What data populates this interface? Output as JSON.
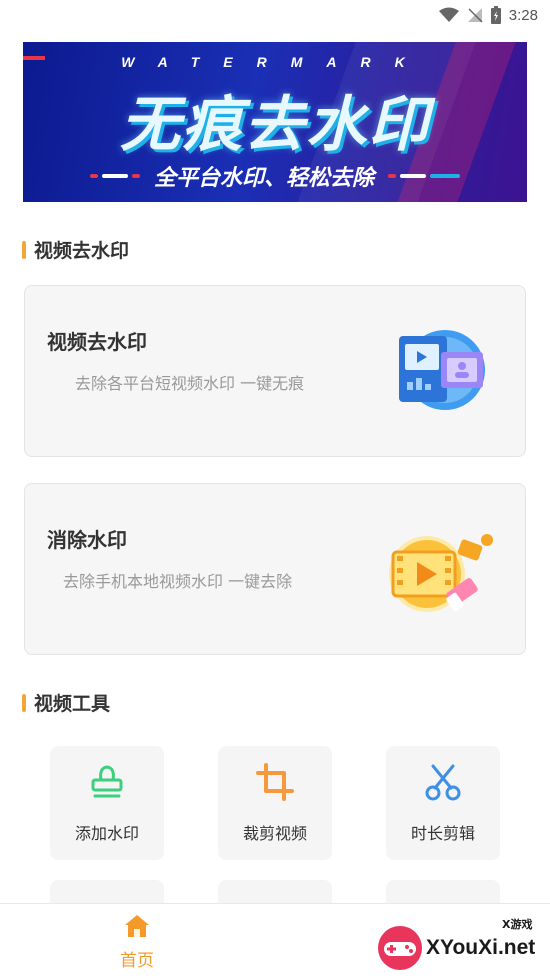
{
  "status_bar": {
    "time": "3:28"
  },
  "banner": {
    "watermark_word": "WATERMARK",
    "headline": "无痕去水印",
    "subline": "全平台水印、轻松去除"
  },
  "sections": {
    "remove_title": "视频去水印",
    "tools_title": "视频工具"
  },
  "cards": [
    {
      "title": "视频去水印",
      "desc": "去除各平台短视频水印 一键无痕",
      "icon": "video-gallery-icon"
    },
    {
      "title": "消除水印",
      "desc": "去除手机本地视频水印 一键去除",
      "icon": "video-eraser-icon"
    }
  ],
  "tools": [
    {
      "label": "添加水印",
      "icon": "stamp-icon",
      "color": "#3ccf7e"
    },
    {
      "label": "裁剪视频",
      "icon": "crop-icon",
      "color": "#f59a3c"
    },
    {
      "label": "时长剪辑",
      "icon": "scissors-icon",
      "color": "#3e8fe6"
    }
  ],
  "bottom_nav": {
    "home_label": "首页"
  },
  "logo": {
    "text": "XYouXi.net",
    "small": "X游戏"
  },
  "colors": {
    "accent": "#f39a2b",
    "banner_bg": "#1a2fb5",
    "section_bar": "#f5a43a"
  }
}
